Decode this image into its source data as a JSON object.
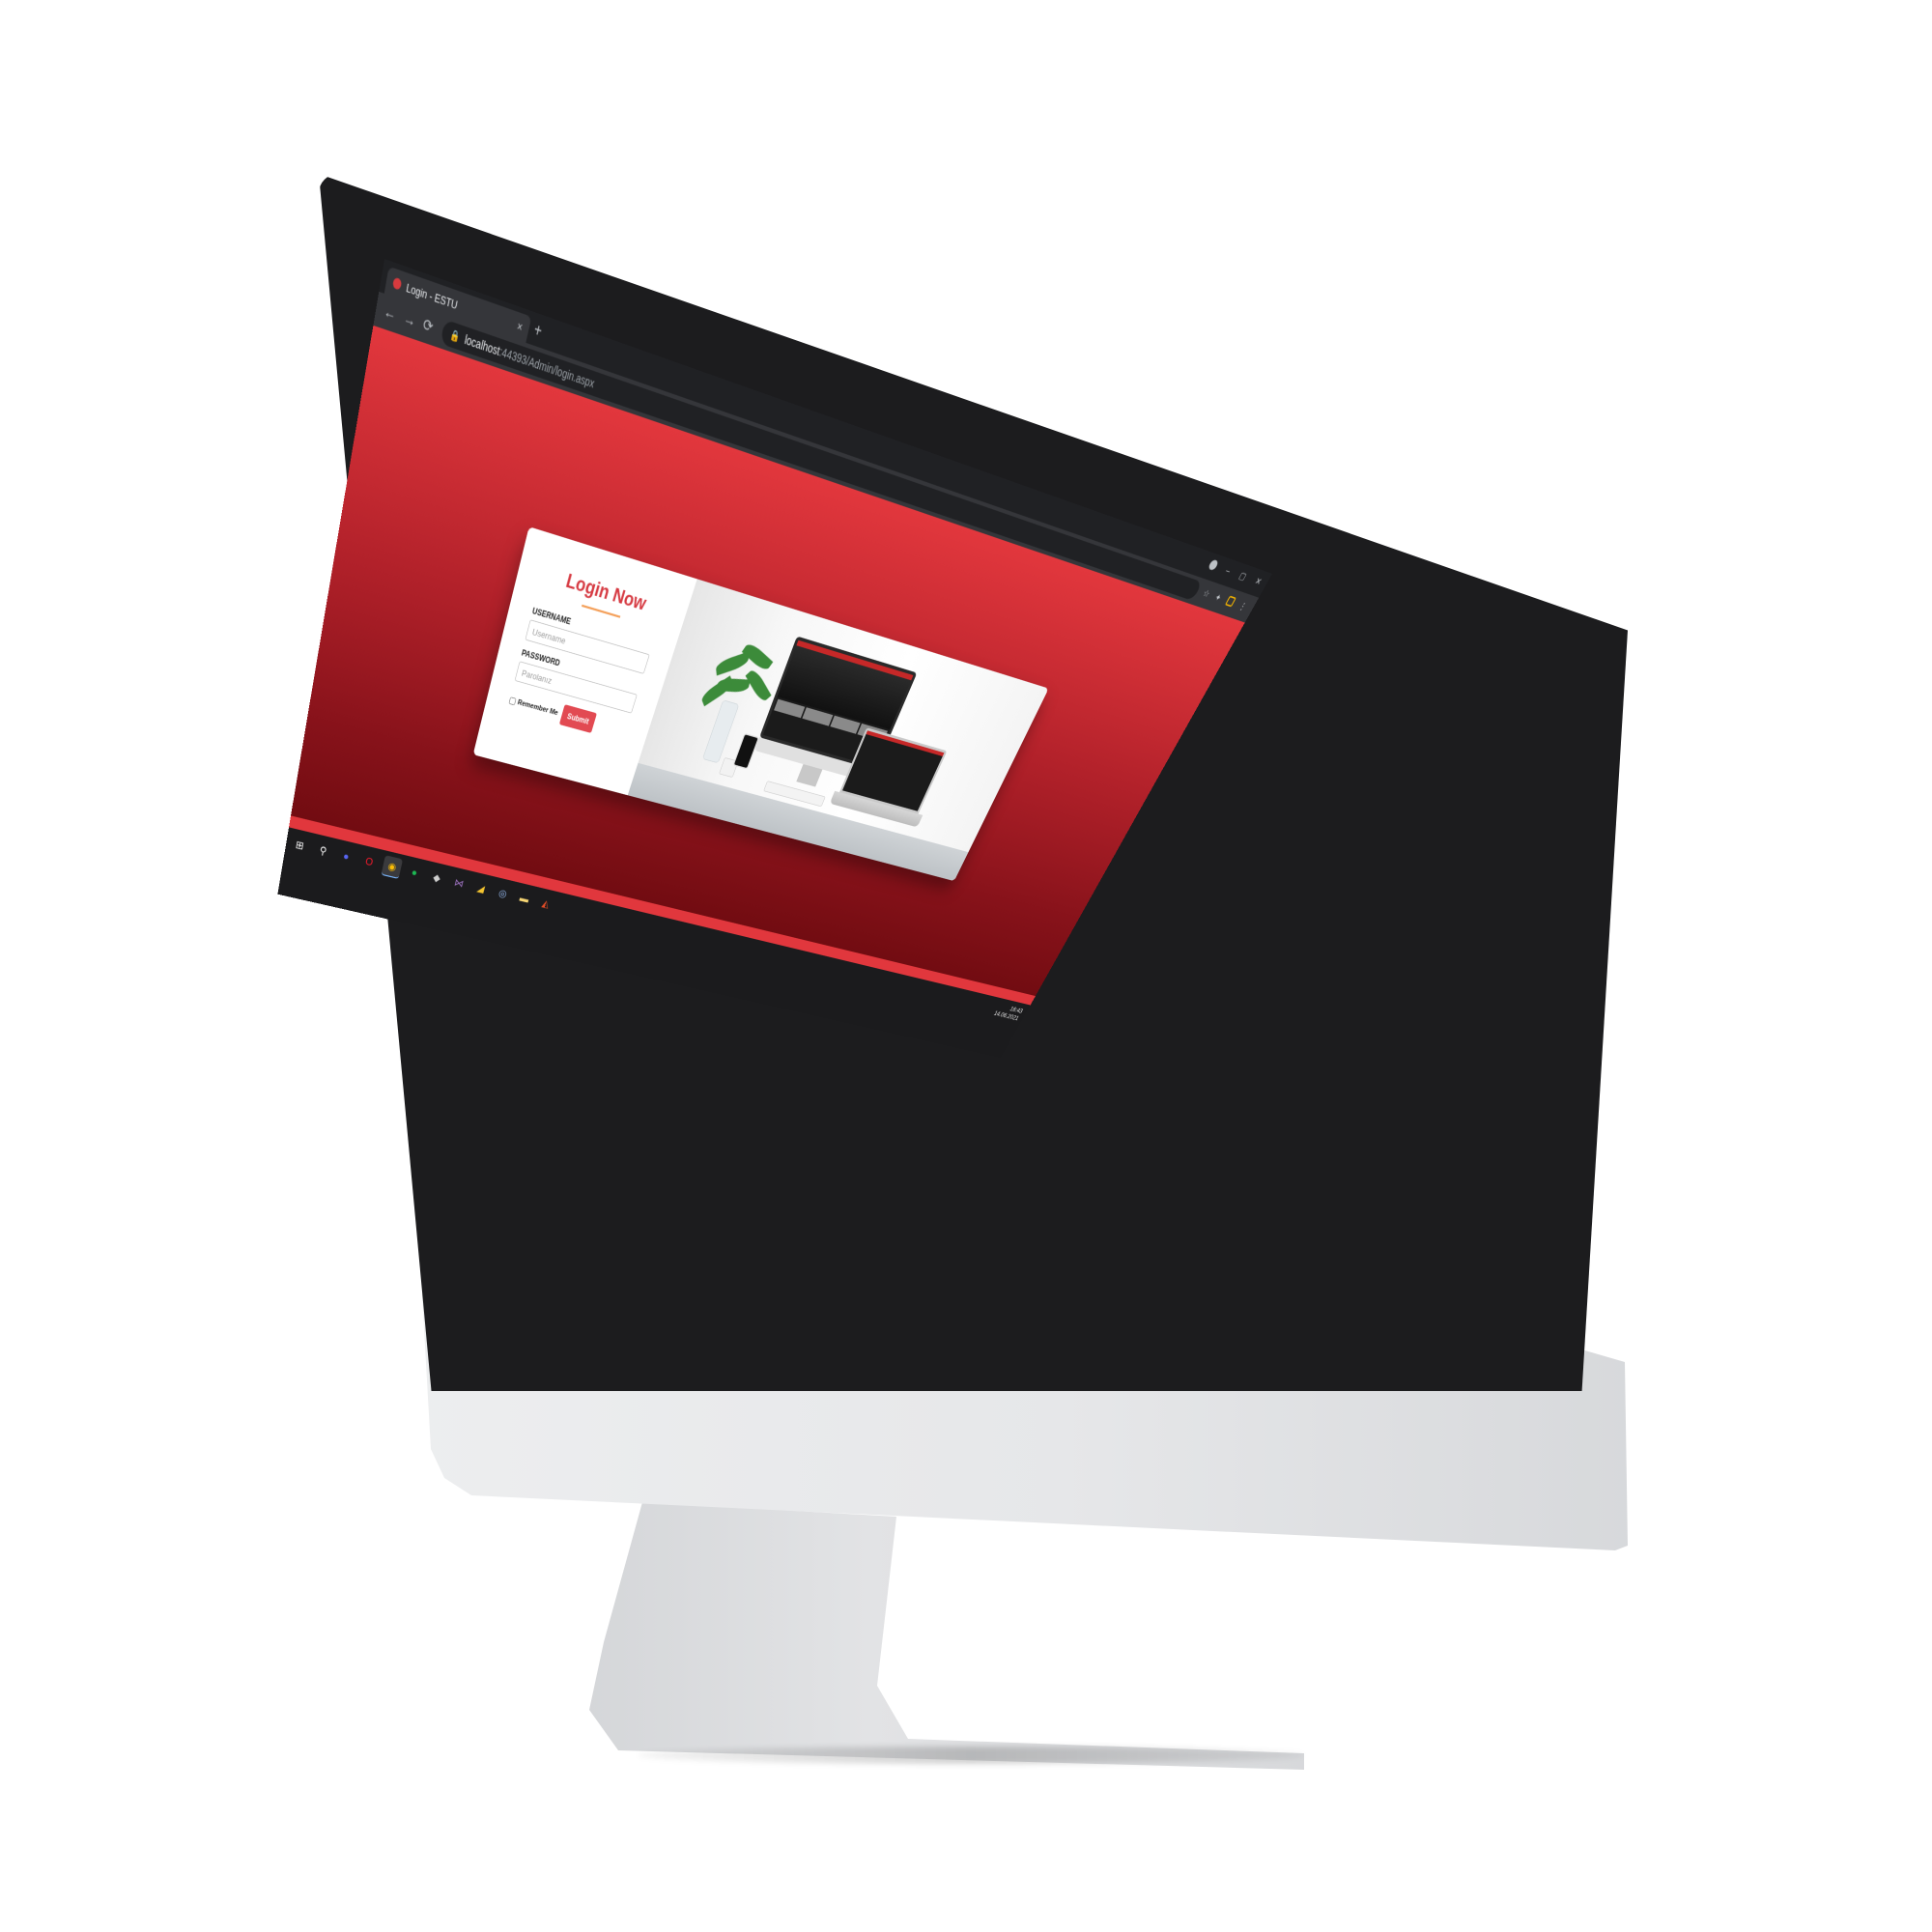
{
  "browser": {
    "tab_title": "Login - ESTU",
    "tab_close": "×",
    "new_tab": "+",
    "nav": {
      "back": "←",
      "forward": "→",
      "reload": "⟳"
    },
    "url_host": "localhost",
    "url_path": ":44393/Admin/login.aspx",
    "lock_icon": "🔒",
    "window_controls": {
      "minimize": "–",
      "maximize": "▢",
      "close": "✕"
    },
    "toolbar_icons": {
      "star": "☆",
      "extensions": "✦",
      "menu": "⋮"
    }
  },
  "login": {
    "title": "Login Now",
    "username_label": "USERNAME",
    "username_placeholder": "Username",
    "password_label": "PASSWORD",
    "password_placeholder": "Parolanız",
    "remember_label": "Remember Me",
    "submit_label": "Submit"
  },
  "taskbar": {
    "icons": [
      {
        "name": "windows-start-icon",
        "glyph": "⊞",
        "color": "#ffffff"
      },
      {
        "name": "search-icon",
        "glyph": "⚲",
        "color": "#ffffff"
      },
      {
        "name": "discord-icon",
        "glyph": "●",
        "color": "#5865f2"
      },
      {
        "name": "opera-icon",
        "glyph": "O",
        "color": "#ff1b2d"
      },
      {
        "name": "chrome-icon",
        "glyph": "◉",
        "color": "#fbbc05"
      },
      {
        "name": "spotify-icon",
        "glyph": "●",
        "color": "#1db954"
      },
      {
        "name": "app-icon",
        "glyph": "◆",
        "color": "#cfcfcf"
      },
      {
        "name": "visual-studio-icon",
        "glyph": "⋈",
        "color": "#a074c4"
      },
      {
        "name": "app-icon-2",
        "glyph": "◢",
        "color": "#f4c430"
      },
      {
        "name": "steam-icon",
        "glyph": "◎",
        "color": "#9ec5ff"
      },
      {
        "name": "file-explorer-icon",
        "glyph": "▬",
        "color": "#f8d775"
      },
      {
        "name": "app-icon-3",
        "glyph": "◭",
        "color": "#e34c26"
      }
    ],
    "clock_time": "16:43",
    "clock_date": "14.06.2021"
  },
  "colors": {
    "accent_red": "#e1373d",
    "title_red": "#d63a42",
    "underline_orange": "#f4a15c",
    "submit_red": "#e24a52"
  }
}
